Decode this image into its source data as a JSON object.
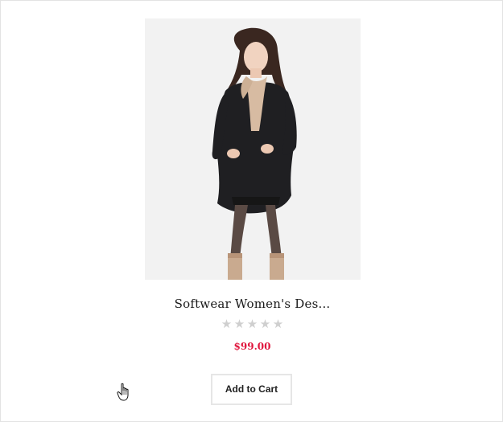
{
  "product": {
    "title": "Softwear Women's Des...",
    "price": "$99.00",
    "rating": 0,
    "rating_max": 5,
    "star_glyph": "★",
    "image_icon": "product-photo",
    "add_to_cart_label": "Add to Cart"
  },
  "colors": {
    "price": "#e0163d",
    "star_empty": "#cfcfcf",
    "image_bg": "#f2f2f2",
    "button_border": "#e6e6e6"
  }
}
